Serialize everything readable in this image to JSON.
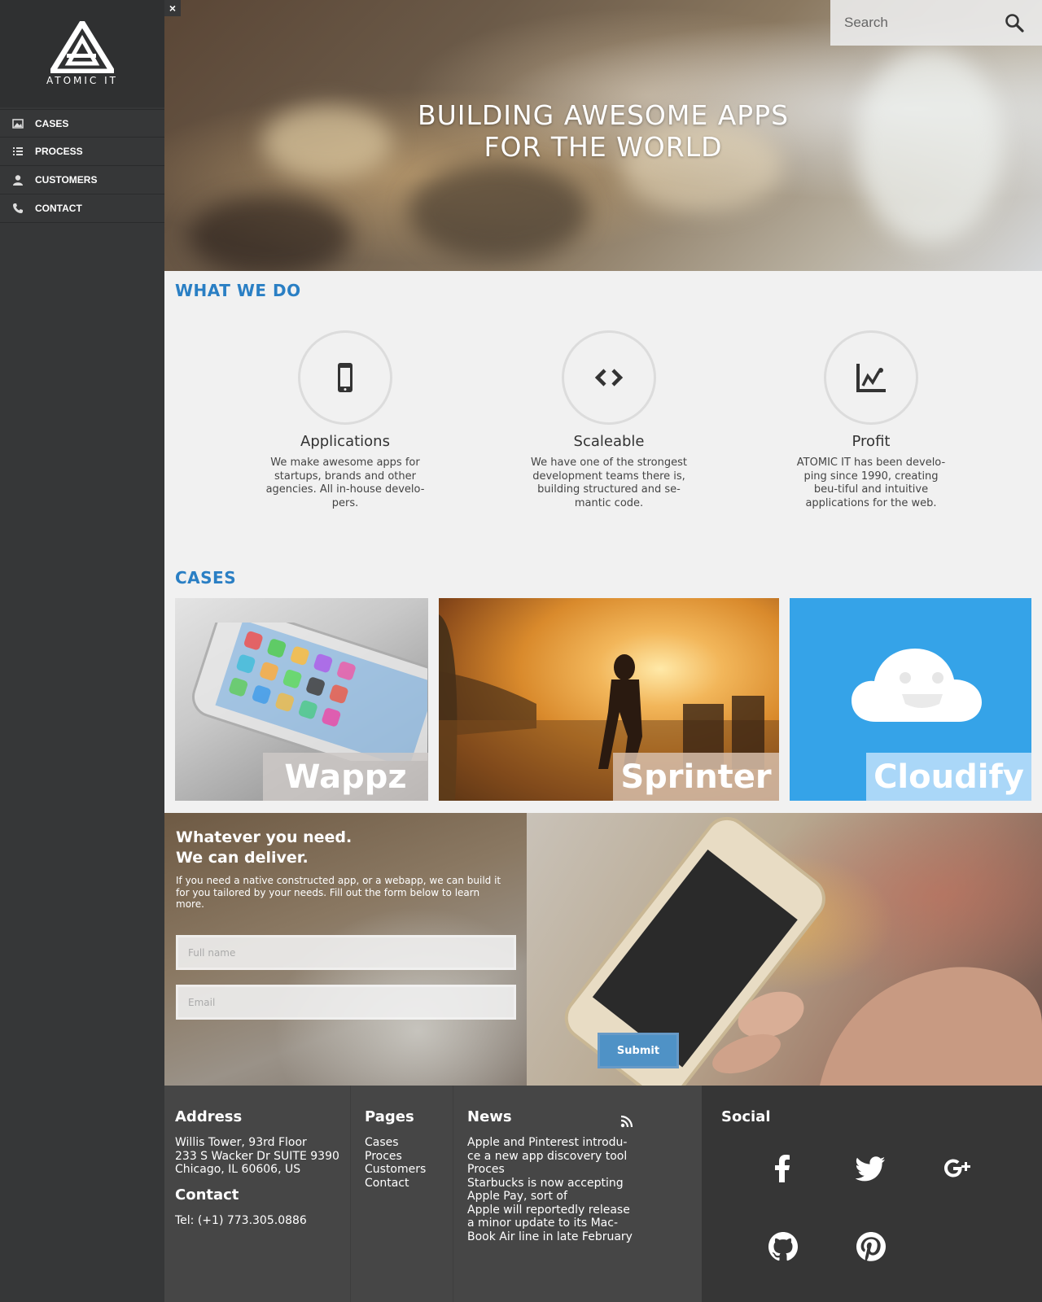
{
  "brand": {
    "name": "ATOMIC IT"
  },
  "close_label": "×",
  "nav": [
    {
      "label": "CASES",
      "icon": "image-icon"
    },
    {
      "label": "PROCESS",
      "icon": "list-icon"
    },
    {
      "label": "CUSTOMERS",
      "icon": "user-icon"
    },
    {
      "label": "CONTACT",
      "icon": "phone-icon"
    }
  ],
  "search": {
    "placeholder": "Search"
  },
  "hero": {
    "line1": "BUILDING AWESOME APPS",
    "line2": "FOR THE WORLD"
  },
  "what_we_do": {
    "title": "WHAT WE DO",
    "services": [
      {
        "title": "Applications",
        "icon": "tablet-icon",
        "text": "We make awesome apps for startups, brands and other agencies. All in-house develo-pers."
      },
      {
        "title": "Scaleable",
        "icon": "code-icon",
        "text": "We have one of the strongest development teams there is, building structured and se-mantic code."
      },
      {
        "title": "Profit",
        "icon": "chart-icon",
        "text": "ATOMIC IT has been develo-ping since 1990, creating beu-tiful and intuitive applications for the web."
      }
    ]
  },
  "cases": {
    "title": "CASES",
    "items": [
      {
        "label": "Wappz"
      },
      {
        "label": "Sprinter"
      },
      {
        "label": "Cloudify"
      }
    ]
  },
  "cta": {
    "heading_line1": "Whatever you need.",
    "heading_line2": "We can deliver.",
    "intro": "If you need a native constructed app, or a webapp, we can build it for you tailored by your needs. Fill out the form below to learn more.",
    "name_placeholder": "Full name",
    "email_placeholder": "Email",
    "submit_label": "Submit"
  },
  "footer": {
    "address_title": "Address",
    "address_lines": [
      "Willis Tower, 93rd Floor",
      "233 S Wacker Dr SUITE 9390",
      "Chicago, IL 60606, US"
    ],
    "contact_title": "Contact",
    "tel": "Tel: (+1) 773.305.0886",
    "pages_title": "Pages",
    "pages": [
      "Cases",
      "Proces",
      "Customers",
      "Contact"
    ],
    "news_title": "News",
    "news_lines": [
      "Apple and Pinterest introdu-",
      "ce a new app discovery tool",
      "Proces",
      "Starbucks is now accepting",
      "Apple Pay, sort of",
      "Apple will reportedly release",
      "a minor update to its Mac-",
      "Book Air line in late February"
    ],
    "social_title": "Social",
    "social": [
      "facebook-icon",
      "twitter-icon",
      "google-plus-icon",
      "github-icon",
      "pinterest-icon"
    ]
  },
  "colors": {
    "accent": "#2a7fc4",
    "sidebar": "#363738",
    "footer": "#464646",
    "cloudify": "#35a3e8"
  }
}
